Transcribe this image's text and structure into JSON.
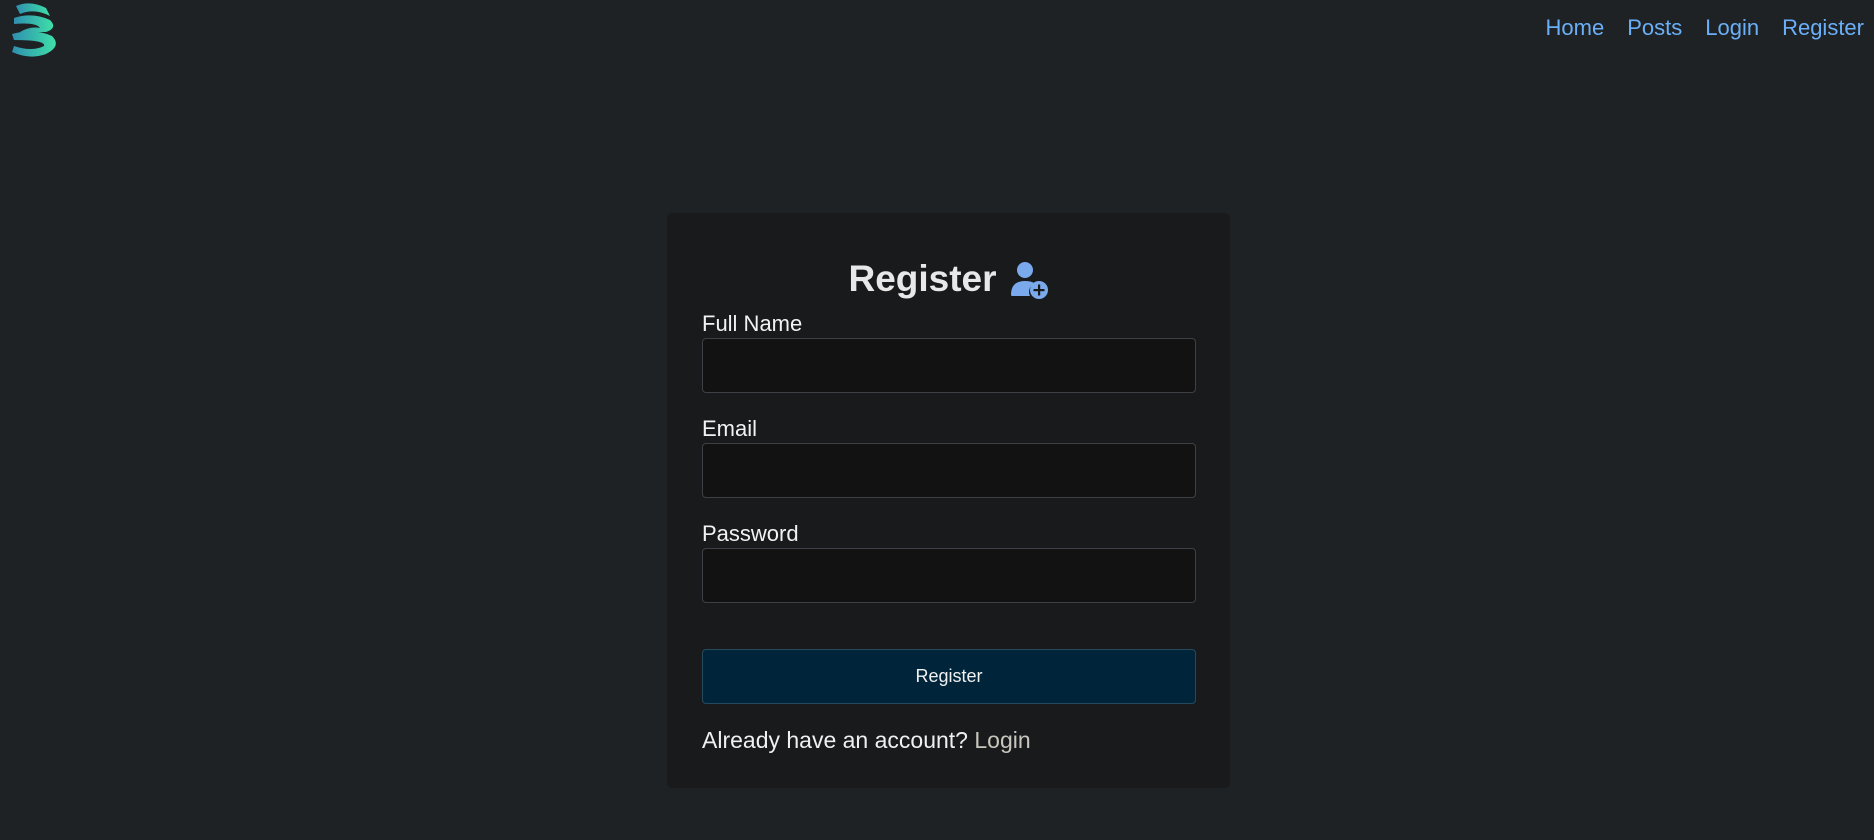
{
  "nav": {
    "home": "Home",
    "posts": "Posts",
    "login": "Login",
    "register": "Register"
  },
  "brand": {
    "logo_icon": "stacked-s-logo",
    "accent_color": "#6aaff7",
    "logo_gradient": [
      "#35a0b8",
      "#3ed8a8"
    ]
  },
  "form": {
    "title": "Register",
    "title_icon": "user-plus-icon",
    "fields": [
      {
        "label": "Full Name",
        "value": "",
        "placeholder": ""
      },
      {
        "label": "Email",
        "value": "",
        "placeholder": ""
      },
      {
        "label": "Password",
        "value": "",
        "placeholder": ""
      }
    ],
    "submit_label": "Register",
    "footer_prompt": "Already have an account?",
    "footer_link": "Login"
  }
}
